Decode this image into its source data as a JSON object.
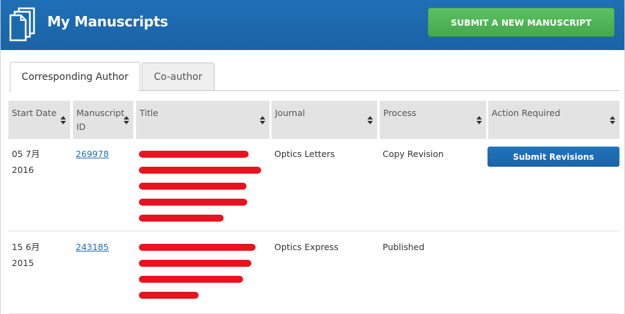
{
  "header": {
    "title": "My Manuscripts",
    "submit_button": "SUBMIT A NEW MANUSCRIPT",
    "icon": "documents-icon"
  },
  "tabs": [
    {
      "label": "Corresponding Author",
      "active": true
    },
    {
      "label": "Co-author",
      "active": false
    }
  ],
  "table": {
    "columns": [
      {
        "line1": "Start Date",
        "line2": ""
      },
      {
        "line1": "Manuscript",
        "line2": "ID"
      },
      {
        "line1": "Title",
        "line2": ""
      },
      {
        "line1": "Journal",
        "line2": ""
      },
      {
        "line1": "Process",
        "line2": ""
      },
      {
        "line1": "Action Required",
        "line2": ""
      }
    ],
    "rows": [
      {
        "date_line1": "05 7月",
        "date_line2": "2016",
        "manuscript_id": "269978",
        "journal": "Optics Letters",
        "process": "Copy Revision",
        "action": "Submit Revisions"
      },
      {
        "date_line1": "15 6月",
        "date_line2": "2015",
        "manuscript_id": "243185",
        "journal": "Optics Express",
        "process": "Published",
        "action": ""
      }
    ]
  },
  "colors": {
    "header_blue": "#1f6fb6",
    "submit_green": "#4db354",
    "action_blue": "#1d68ad",
    "redaction_red": "#e8131f",
    "link_blue": "#1f6fb6"
  }
}
